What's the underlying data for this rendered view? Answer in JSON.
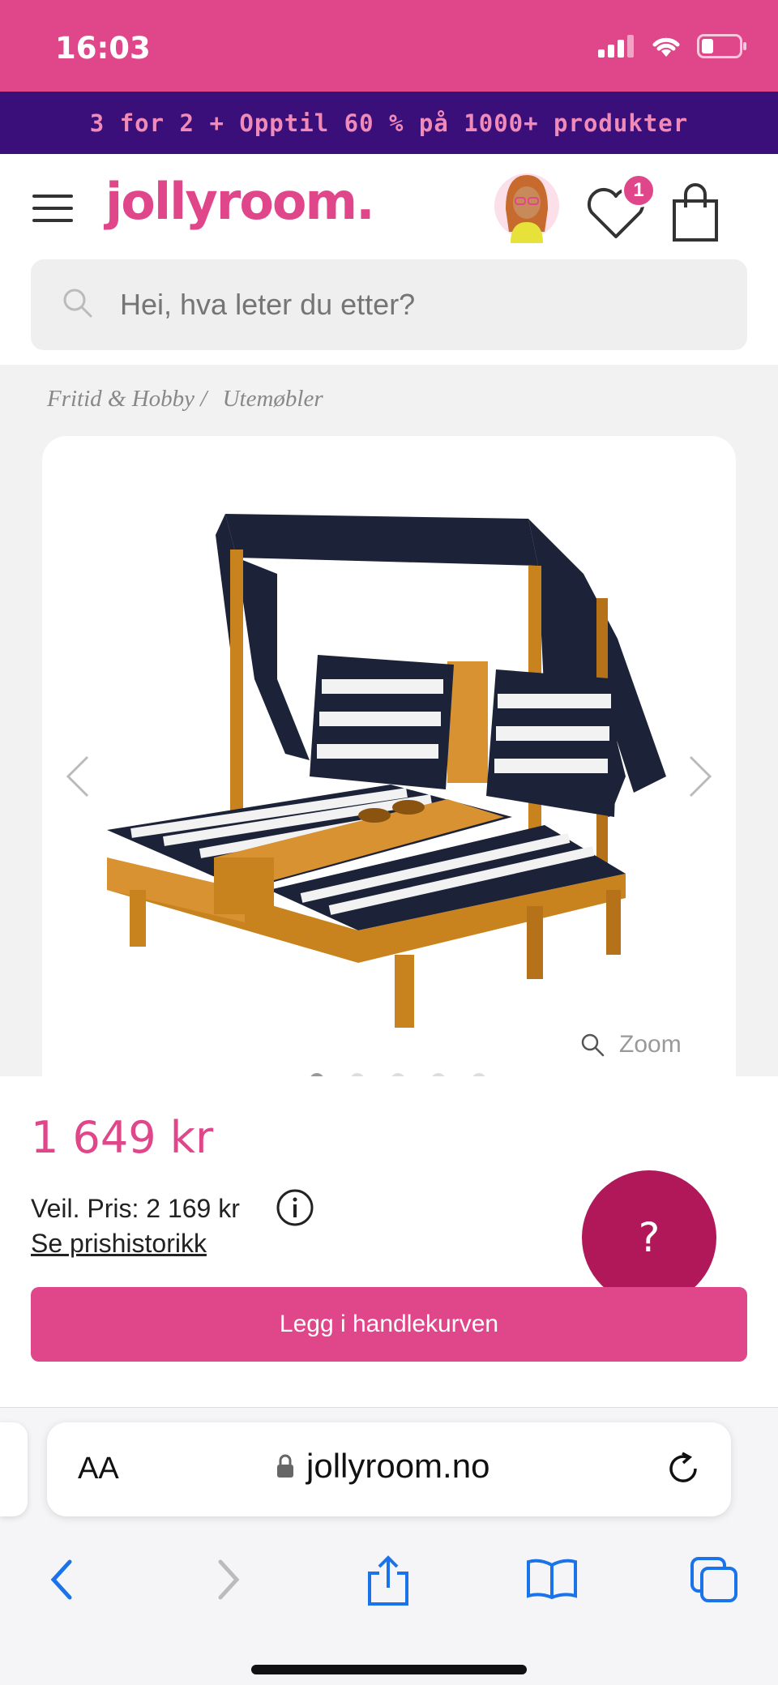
{
  "status": {
    "time": "16:03"
  },
  "promo": {
    "text": "3 for 2 + Opptil 60 % på 1000+ produkter"
  },
  "header": {
    "logo": "jollyroom.",
    "wishlist_count": "1",
    "search_placeholder": "Hei, hva leter du etter?"
  },
  "breadcrumb": {
    "items": [
      "Fritid & Hobby /",
      "Utemøbler"
    ]
  },
  "gallery": {
    "zoom_label": "Zoom",
    "image_count": 5,
    "active_index": 0
  },
  "product": {
    "price": "1 649 kr",
    "rrp": "Veil. Pris: 2 169 kr",
    "history_link": "Se prishistorikk",
    "add_to_cart": "Legg i handlekurven",
    "help_label": "?"
  },
  "browser": {
    "text_size_label": "AA",
    "url": "jollyroom.no"
  },
  "colors": {
    "brand_pink": "#e0468a",
    "promo_purple": "#3a0f7a",
    "help_magenta": "#b0185a"
  }
}
